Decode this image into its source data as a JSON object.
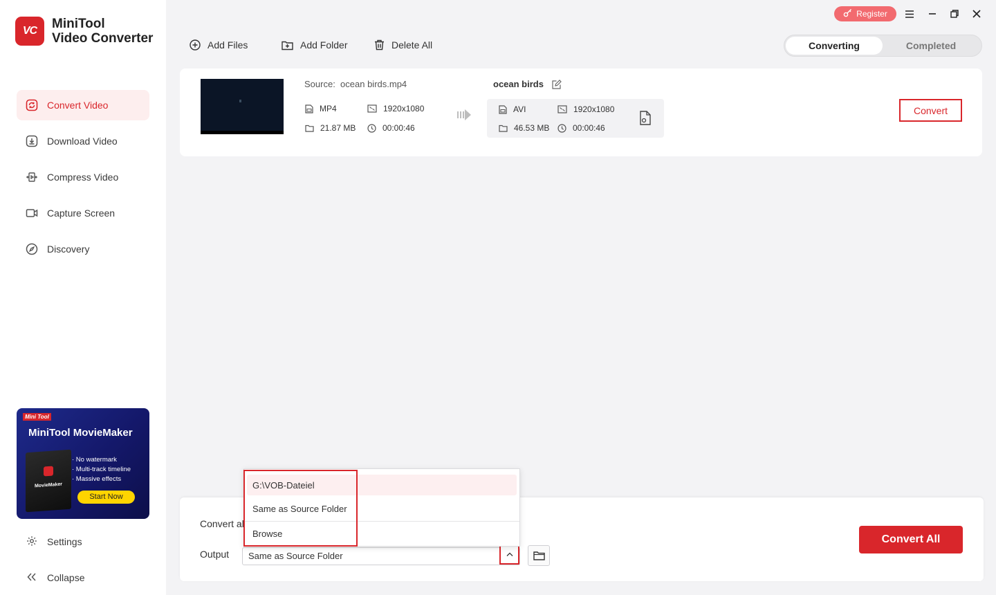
{
  "app": {
    "logo_text": "VC",
    "title_line1": "MiniTool",
    "title_line2": "Video Converter"
  },
  "sidebar": {
    "items": [
      {
        "label": "Convert Video",
        "icon": "convert-icon",
        "active": true
      },
      {
        "label": "Download Video",
        "icon": "download-icon",
        "active": false
      },
      {
        "label": "Compress Video",
        "icon": "compress-icon",
        "active": false
      },
      {
        "label": "Capture Screen",
        "icon": "camera-icon",
        "active": false
      },
      {
        "label": "Discovery",
        "icon": "compass-icon",
        "active": false
      }
    ],
    "settings_label": "Settings",
    "collapse_label": "Collapse"
  },
  "promo": {
    "brand": "Mini Tool",
    "title": "MiniTool MovieMaker",
    "box_label": "MovieMaker",
    "features": [
      "· No watermark",
      "· Multi-track timeline",
      "· Massive effects"
    ],
    "button": "Start Now"
  },
  "titlebar": {
    "register_label": "Register",
    "menu_icon": "hamburger-icon",
    "minimize_icon": "minimize-icon",
    "restore_icon": "restore-icon",
    "close_icon": "close-icon"
  },
  "toolbar": {
    "add_files": "Add Files",
    "add_folder": "Add Folder",
    "delete_all": "Delete All"
  },
  "tabs": {
    "converting": "Converting",
    "completed": "Completed"
  },
  "task": {
    "source_label": "Source:",
    "source_file": "ocean birds.mp4",
    "source_format": "MP4",
    "source_resolution": "1920x1080",
    "source_size": "21.87 MB",
    "source_duration": "00:00:46",
    "target_name": "ocean birds",
    "target_format": "AVI",
    "target_resolution": "1920x1080",
    "target_size": "46.53 MB",
    "target_duration": "00:00:46",
    "convert_label": "Convert"
  },
  "bottom": {
    "convert_all_label": "Convert al",
    "output_label": "Output",
    "output_value": "Same as Source Folder",
    "convert_all_button": "Convert All"
  },
  "dropdown": {
    "options": [
      "G:\\VOB-Dateiel",
      "Same as Source Folder",
      "Browse"
    ]
  },
  "colors": {
    "accent": "#d9262b",
    "register": "#f26a6f",
    "active_bg": "#fdeeee"
  }
}
